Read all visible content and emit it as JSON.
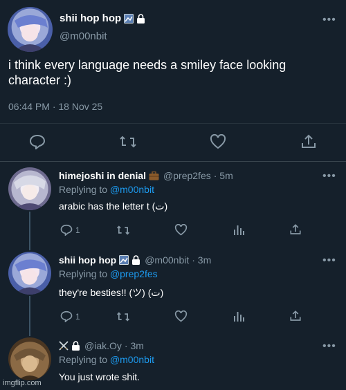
{
  "main_tweet": {
    "display_name": "shii hop hop",
    "handle": "@m00nbit",
    "text": "i think every language needs a smiley face looking character :)",
    "timestamp": "06:44 PM · 18 Nov 25"
  },
  "replies": [
    {
      "display_name": "himejoshi in denial",
      "handle": "@prep2fes",
      "time": "· 5m",
      "replying_label": "Replying to",
      "replying_to": "@m00nbit",
      "text": "arabic has the letter t (ت)",
      "reply_count": "1"
    },
    {
      "display_name": "shii hop hop",
      "handle": "@m00nbit",
      "time": "· 3m",
      "replying_label": "Replying to",
      "replying_to": "@prep2fes",
      "text": "they're besties!! (ツ) (ت)",
      "reply_count": "1"
    },
    {
      "display_name": "",
      "handle": "@iak.Oy",
      "time": "· 3m",
      "replying_label": "Replying to",
      "replying_to": "@m00nbit",
      "text": "You just wrote shit."
    }
  ],
  "watermark": "imgflip.com",
  "colors": {
    "background": "#15202b",
    "muted": "#8899a6",
    "link": "#1d9bf0",
    "divider": "#38444d"
  },
  "icons": [
    "more-icon",
    "lock-icon",
    "reply-icon",
    "retweet-icon",
    "like-icon",
    "share-icon",
    "analytics-icon",
    "briefcase-icon",
    "swords-icon"
  ]
}
